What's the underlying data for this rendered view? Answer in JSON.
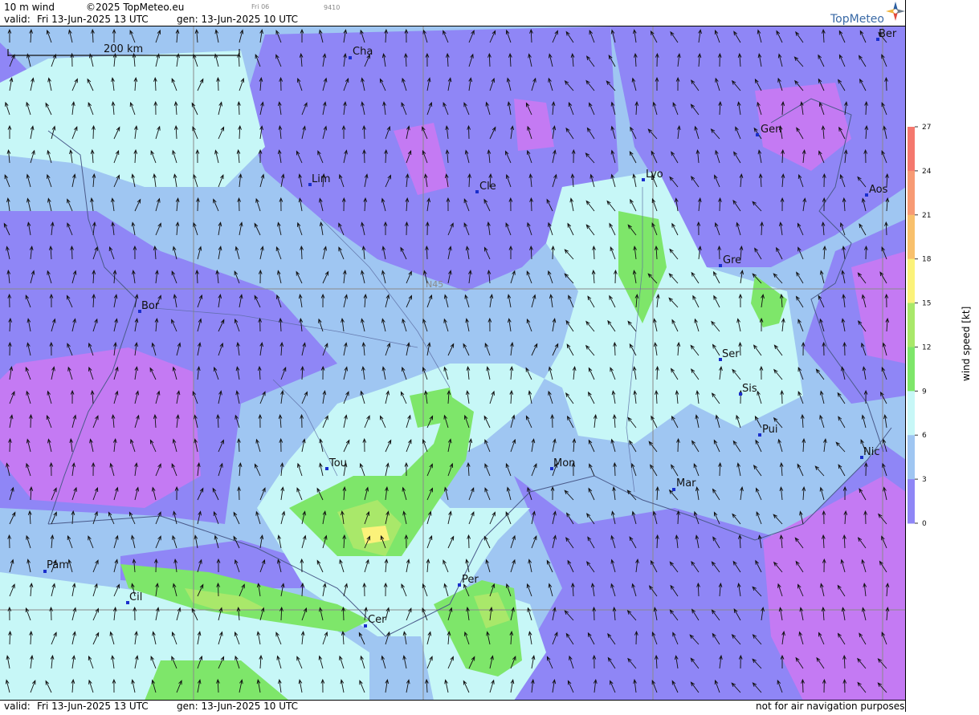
{
  "header": {
    "product": "10 m wind",
    "copyright": "©2025 TopMeteo.eu",
    "small_tag": "Fri 06",
    "small_code": "9410",
    "valid_label": "valid:",
    "valid_value": "Fri  13-Jun-2025  13 UTC",
    "gen_value": "gen: 13-Jun-2025 10 UTC"
  },
  "logo": {
    "text": "TopMeteo"
  },
  "scale_bar": {
    "label": "200 km"
  },
  "grid_label": "N45",
  "cities": [
    {
      "name": "Cha"
    },
    {
      "name": "Ber"
    },
    {
      "name": "Gen"
    },
    {
      "name": "Lim"
    },
    {
      "name": "Cle"
    },
    {
      "name": "Lyo"
    },
    {
      "name": "Aos"
    },
    {
      "name": "Gre"
    },
    {
      "name": "Bor"
    },
    {
      "name": "Ser"
    },
    {
      "name": "Sis"
    },
    {
      "name": "Pui"
    },
    {
      "name": "Tou"
    },
    {
      "name": "Mon"
    },
    {
      "name": "Nic"
    },
    {
      "name": "Mar"
    },
    {
      "name": "Pam"
    },
    {
      "name": "Cil"
    },
    {
      "name": "Per"
    },
    {
      "name": "Cer"
    }
  ],
  "legend": {
    "title": "wind speed [kt]",
    "ticks": [
      "27",
      "24",
      "21",
      "18",
      "15",
      "12",
      "9",
      "6",
      "3",
      "0"
    ],
    "colors": [
      "#f4786e",
      "#f79a74",
      "#f8c06c",
      "#fbf27a",
      "#a9e86a",
      "#7ee66a",
      "#c7f7f7",
      "#9fc6f2",
      "#8f86f6",
      "#c47af3"
    ]
  },
  "footer": {
    "valid_label": "valid:",
    "valid_value": "Fri  13-Jun-2025  13 UTC",
    "gen_value": "gen: 13-Jun-2025 10 UTC",
    "disclaimer": "not for air navigation purposes"
  }
}
